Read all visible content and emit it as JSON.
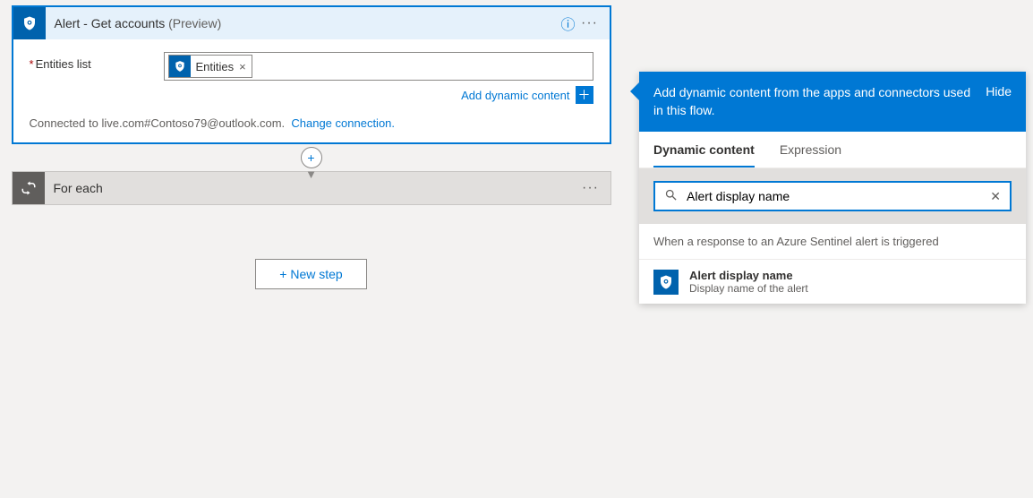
{
  "action": {
    "title": "Alert - Get accounts",
    "preview_suffix": "(Preview)",
    "field_label": "Entities list",
    "token_label": "Entities",
    "add_dynamic_label": "Add dynamic content",
    "connected_text": "Connected to live.com#Contoso79@outlook.com.",
    "change_connection": "Change connection."
  },
  "foreach": {
    "title": "For each"
  },
  "new_step": "+ New step",
  "panel": {
    "header": "Add dynamic content from the apps and connectors used in this flow.",
    "hide": "Hide",
    "tabs": {
      "dynamic": "Dynamic content",
      "expression": "Expression"
    },
    "search_value": "Alert display name",
    "section": "When a response to an Azure Sentinel alert is triggered",
    "result": {
      "title": "Alert display name",
      "desc": "Display name of the alert"
    }
  }
}
